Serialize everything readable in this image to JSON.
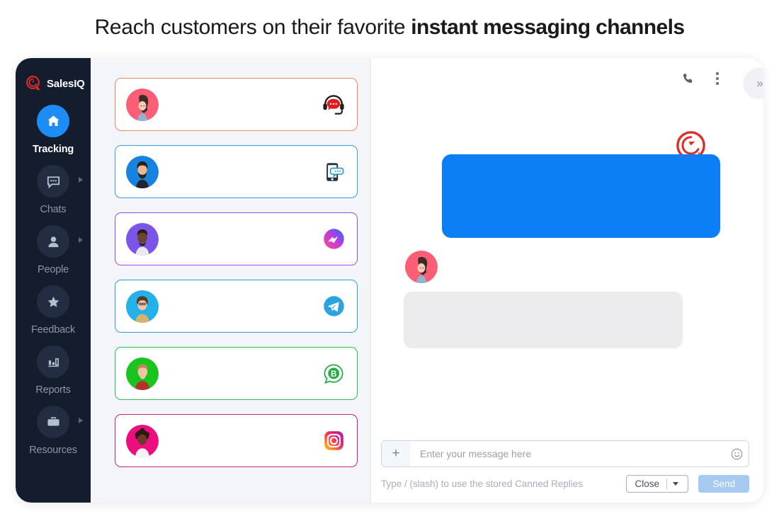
{
  "headline": {
    "light_part": "Reach customers on their favorite ",
    "bold_part": "instant messaging channels"
  },
  "colors": {
    "sidebar_bg": "#141d2e",
    "accent_blue": "#1e8cf5",
    "bubble_blue": "#0b7ef5",
    "brand_red": "#e02b27",
    "list_bg": "#f4f5f9",
    "send_button": "#a6caef"
  },
  "sidebar": {
    "brand_name": "SalesIQ",
    "brand_logo_icon": "salesiq-logo-icon",
    "items": [
      {
        "label": "Tracking",
        "icon": "home-icon",
        "active": true,
        "has_submenu": false
      },
      {
        "label": "Chats",
        "icon": "chat-bubble-icon",
        "active": false,
        "has_submenu": true
      },
      {
        "label": "People",
        "icon": "person-icon",
        "active": false,
        "has_submenu": true
      },
      {
        "label": "Feedback",
        "icon": "star-icon",
        "active": false,
        "has_submenu": false
      },
      {
        "label": "Reports",
        "icon": "bar-chart-icon",
        "active": false,
        "has_submenu": false
      },
      {
        "label": "Resources",
        "icon": "briefcase-icon",
        "active": false,
        "has_submenu": true
      }
    ]
  },
  "chat_list": {
    "rows": [
      {
        "channel": "live-chat",
        "channel_icon": "live-chat-headset-icon",
        "border_color": "#f08a5d",
        "avatar_bg": "#fb5e75",
        "avatar_style": "woman-long-hair"
      },
      {
        "channel": "sms",
        "channel_icon": "sms-mobile-icon",
        "border_color": "#3c9ae0",
        "avatar_bg": "#1783e0",
        "avatar_style": "bearded-man"
      },
      {
        "channel": "facebook-messenger",
        "channel_icon": "messenger-icon",
        "border_color": "#9b4dea",
        "avatar_bg": "#7b54e8",
        "avatar_style": "man-short-hair"
      },
      {
        "channel": "telegram",
        "channel_icon": "telegram-icon",
        "border_color": "#2aa3cc",
        "avatar_bg": "#24b0e8",
        "avatar_style": "woman-glasses"
      },
      {
        "channel": "whatsapp-business",
        "channel_icon": "whatsapp-business-icon",
        "border_color": "#2cc14f",
        "avatar_bg": "#18c41d",
        "avatar_style": "blond-man"
      },
      {
        "channel": "instagram",
        "channel_icon": "instagram-icon",
        "border_color": "#c2267a",
        "avatar_bg": "#ec0d7e",
        "avatar_style": "woman-afro"
      }
    ]
  },
  "conversation": {
    "top_bar": {
      "call_icon": "phone-call-icon",
      "menu_icon": "kebab-menu-icon",
      "expand_label": "»",
      "expand_icon": "chevron-double-right-icon"
    },
    "watermark_icon": "salesiq-logo-watermark",
    "outgoing_bubble": {
      "line_widths": [
        313,
        282,
        180
      ]
    },
    "incoming_bubble": {
      "line_widths": [
        268,
        165
      ]
    },
    "incoming_avatar_style": "woman-long-hair"
  },
  "composer": {
    "attach_label": "+",
    "attach_icon": "plus-icon",
    "input_placeholder": "Enter your message here",
    "input_value": "",
    "emoji_icon": "smiley-icon",
    "hint": "Type / (slash) to use the stored Canned Replies",
    "status_select_label": "Close",
    "status_select_icon": "chevron-down-icon",
    "send_label": "Send"
  }
}
